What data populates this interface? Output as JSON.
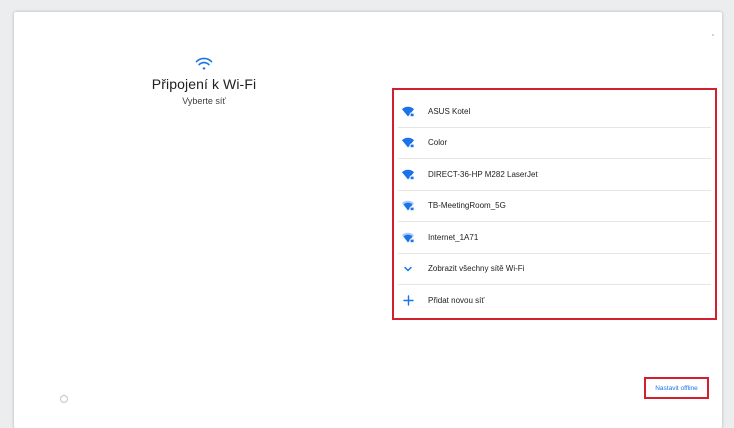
{
  "wifi_setup": {
    "title": "Připojení k Wi-Fi",
    "subtitle": "Vyberte síť",
    "header_icon": "wifi-icon"
  },
  "networks": [
    {
      "label": "ASUS Kotel",
      "icon": "wifi-locked-icon"
    },
    {
      "label": "Color",
      "icon": "wifi-locked-icon"
    },
    {
      "label": "DIRECT-36-HP M282 LaserJet",
      "icon": "wifi-locked-icon"
    },
    {
      "label": "TB-MeetingRoom_5G",
      "icon": "wifi-locked-icon"
    },
    {
      "label": "Internet_1A71",
      "icon": "wifi-locked-icon"
    }
  ],
  "actions": {
    "show_all_label": "Zobrazit všechny sítě Wi-Fi",
    "show_all_icon": "chevron-down-icon",
    "add_network_label": "Přidat novou síť",
    "add_network_icon": "plus-icon",
    "offline_label": "Nastavit offline"
  },
  "colors": {
    "accent": "#1a73e8",
    "highlight": "#d3202f"
  }
}
